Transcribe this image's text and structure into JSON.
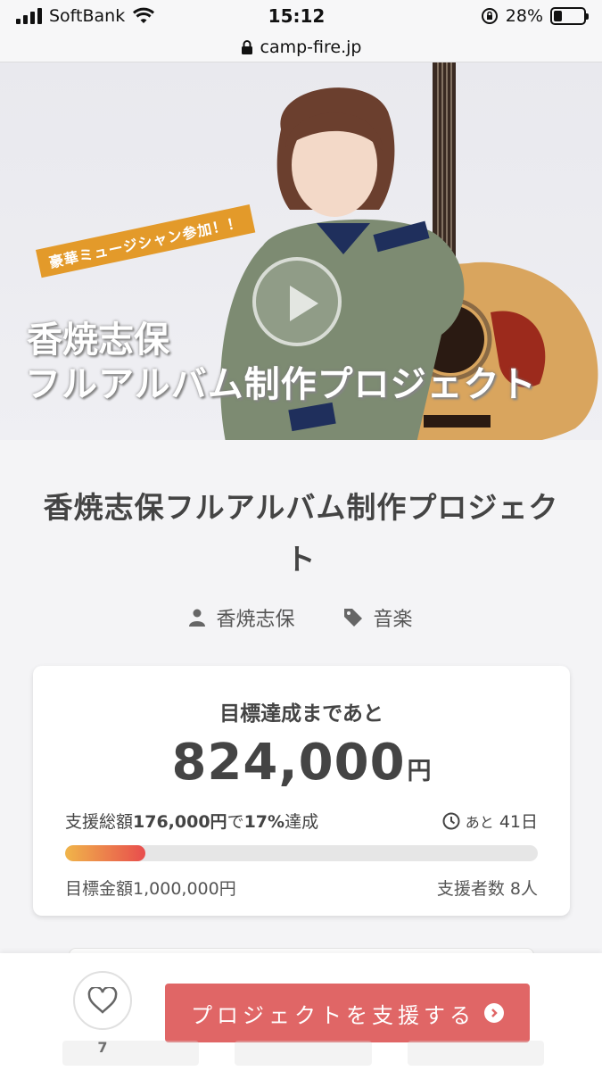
{
  "status_bar": {
    "carrier": "SoftBank",
    "time": "15:12",
    "battery": "28%",
    "battery_level": 0.28
  },
  "url_bar": {
    "domain": "camp-fire.jp"
  },
  "hero": {
    "badge": "豪華ミュージシャン参加！！",
    "title_line1": "香焼志保",
    "title_line2": "フルアルバム制作プロジェクト"
  },
  "project": {
    "title": "香焼志保フルアルバム制作プロジェクト",
    "owner": "香焼志保",
    "category": "音楽"
  },
  "funding": {
    "heading": "目標達成まであと",
    "remaining_amount": "824,000",
    "remaining_unit": "円",
    "raised_prefix": "支援総額",
    "raised_amount": "176,000円",
    "raised_mid": "で",
    "percent": "17%",
    "percent_suffix": "達成",
    "progress_fraction": 0.17,
    "days_prefix": "あと",
    "days_value": "41日",
    "goal_label": "目標金額",
    "goal_amount": "1,000,000円",
    "backers_label": "支援者数",
    "backers_count": "8人"
  },
  "bottom_bar": {
    "favorite_count": "7",
    "support_button": "プロジェクトを支援する"
  },
  "colors": {
    "accent_button": "#e06666",
    "progress_start": "#f0b54a",
    "progress_end": "#e84d4d"
  }
}
